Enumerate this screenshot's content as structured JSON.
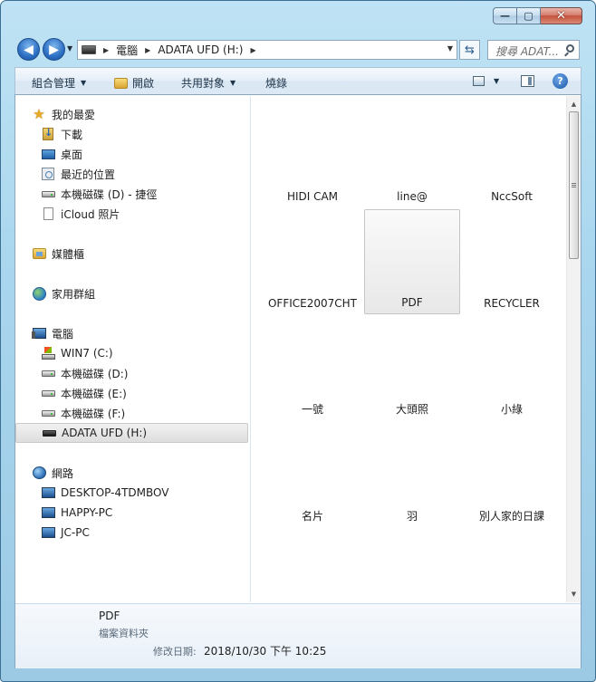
{
  "window": {
    "caption": {
      "minimize": "—",
      "maximize": "▢",
      "close": "✕"
    }
  },
  "addressbar": {
    "crumbs": [
      "電腦",
      "ADATA UFD (H:)"
    ],
    "search_placeholder": "搜尋 ADAT..."
  },
  "toolbar": {
    "organize": "組合管理",
    "open": "開啟",
    "share": "共用對象",
    "burn": "燒錄"
  },
  "nav": {
    "favorites": "我的最愛",
    "downloads": "下載",
    "desktop": "桌面",
    "recent": "最近的位置",
    "shortcut_d": "本機磁碟 (D) - 捷徑",
    "icloud": "iCloud 照片",
    "libraries": "媒體櫃",
    "homegroup": "家用群組",
    "computer": "電腦",
    "drive_c": "WIN7 (C:)",
    "drive_d": "本機磁碟 (D:)",
    "drive_e": "本機磁碟 (E:)",
    "drive_f": "本機磁碟 (F:)",
    "drive_h": "ADATA UFD (H:)",
    "network": "網路",
    "pc1": "DESKTOP-4TDMBOV",
    "pc2": "HAPPY-PC",
    "pc3": "JC-PC"
  },
  "items": [
    "HIDI CAM",
    "line@",
    "NccSoft",
    "OFFICE2007CHT",
    "PDF",
    "RECYCLER",
    "一號",
    "大頭照",
    "小綠",
    "名片",
    "羽",
    "別人家的日課"
  ],
  "selected_item": "PDF",
  "details": {
    "name": "PDF",
    "type": "檔案資料夾",
    "date_label": "修改日期:",
    "date_value": "2018/10/30 下午 10:25"
  },
  "icons": {
    "back": "back-arrow-icon",
    "forward": "forward-arrow-icon",
    "refresh": "refresh-icon",
    "search": "search-icon",
    "help": "help-icon"
  }
}
